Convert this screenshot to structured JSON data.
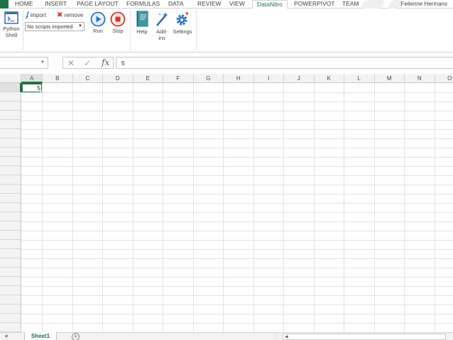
{
  "tabs": {
    "home": "HOME",
    "insert": "INSERT",
    "page_layout": "PAGE LAYOUT",
    "formulas": "FORMULAS",
    "data": "DATA",
    "review": "REVIEW",
    "view": "VIEW",
    "datanitro": "DataNitro",
    "powerpivot": "POWERPIVOT",
    "team": "TEAM"
  },
  "user_name": "Felienne Hermans",
  "ribbon": {
    "python_shell_line1": "Python",
    "python_shell_line2": "Shell",
    "import_label": "import",
    "remove_label": "remove",
    "scripts_dropdown_value": "No scripts imported",
    "run_label": "Run",
    "stop_label": "Stop",
    "help_label": "Help",
    "addins_line1": "Add-",
    "addins_line2": "ins",
    "settings_label": "Settings"
  },
  "formula_bar": {
    "name_box": "",
    "fx": "fx",
    "value": "5"
  },
  "columns": [
    "A",
    "B",
    "C",
    "D",
    "E",
    "F",
    "G",
    "H",
    "I",
    "J",
    "K",
    "L",
    "M",
    "N",
    "O"
  ],
  "cells": {
    "A1": "5"
  },
  "sheets": {
    "active": "Sheet1",
    "add": "+"
  },
  "colors": {
    "accent": "#217346",
    "run_blue": "#2b74c6",
    "stop_red": "#d9342b"
  }
}
